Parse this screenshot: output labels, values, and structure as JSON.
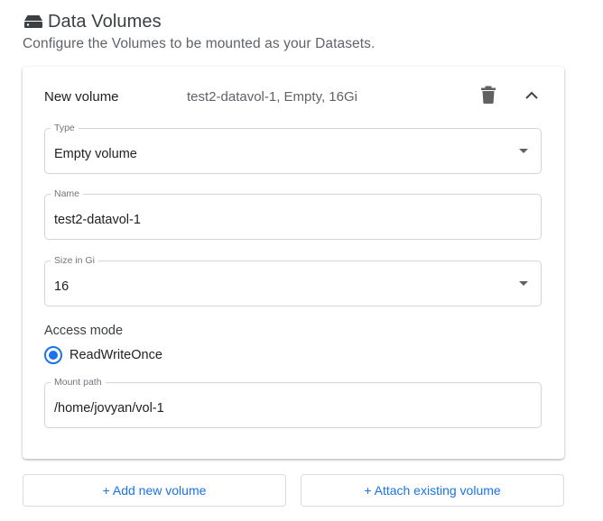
{
  "section": {
    "title": "Data Volumes",
    "subtitle": "Configure the Volumes to be mounted as your Datasets.",
    "icon": "storage-icon"
  },
  "volume": {
    "name": "New volume",
    "summary": "test2-datavol-1, Empty, 16Gi",
    "delete_icon": "trash-icon",
    "collapse_icon": "chevron-up-icon",
    "type": {
      "label": "Type",
      "value": "Empty volume"
    },
    "name_field": {
      "label": "Name",
      "value": "test2-datavol-1"
    },
    "size": {
      "label": "Size in Gi",
      "value": "16"
    },
    "access_mode": {
      "title": "Access mode",
      "option": "ReadWriteOnce",
      "selected": true
    },
    "mount_path": {
      "label": "Mount path",
      "value": "/home/jovyan/vol-1"
    }
  },
  "actions": {
    "add_new": "+ Add new volume",
    "attach_existing": "+ Attach existing volume"
  },
  "colors": {
    "accent": "#1a73e8",
    "border": "#d2d4d7",
    "muted_text": "#5f6368"
  }
}
